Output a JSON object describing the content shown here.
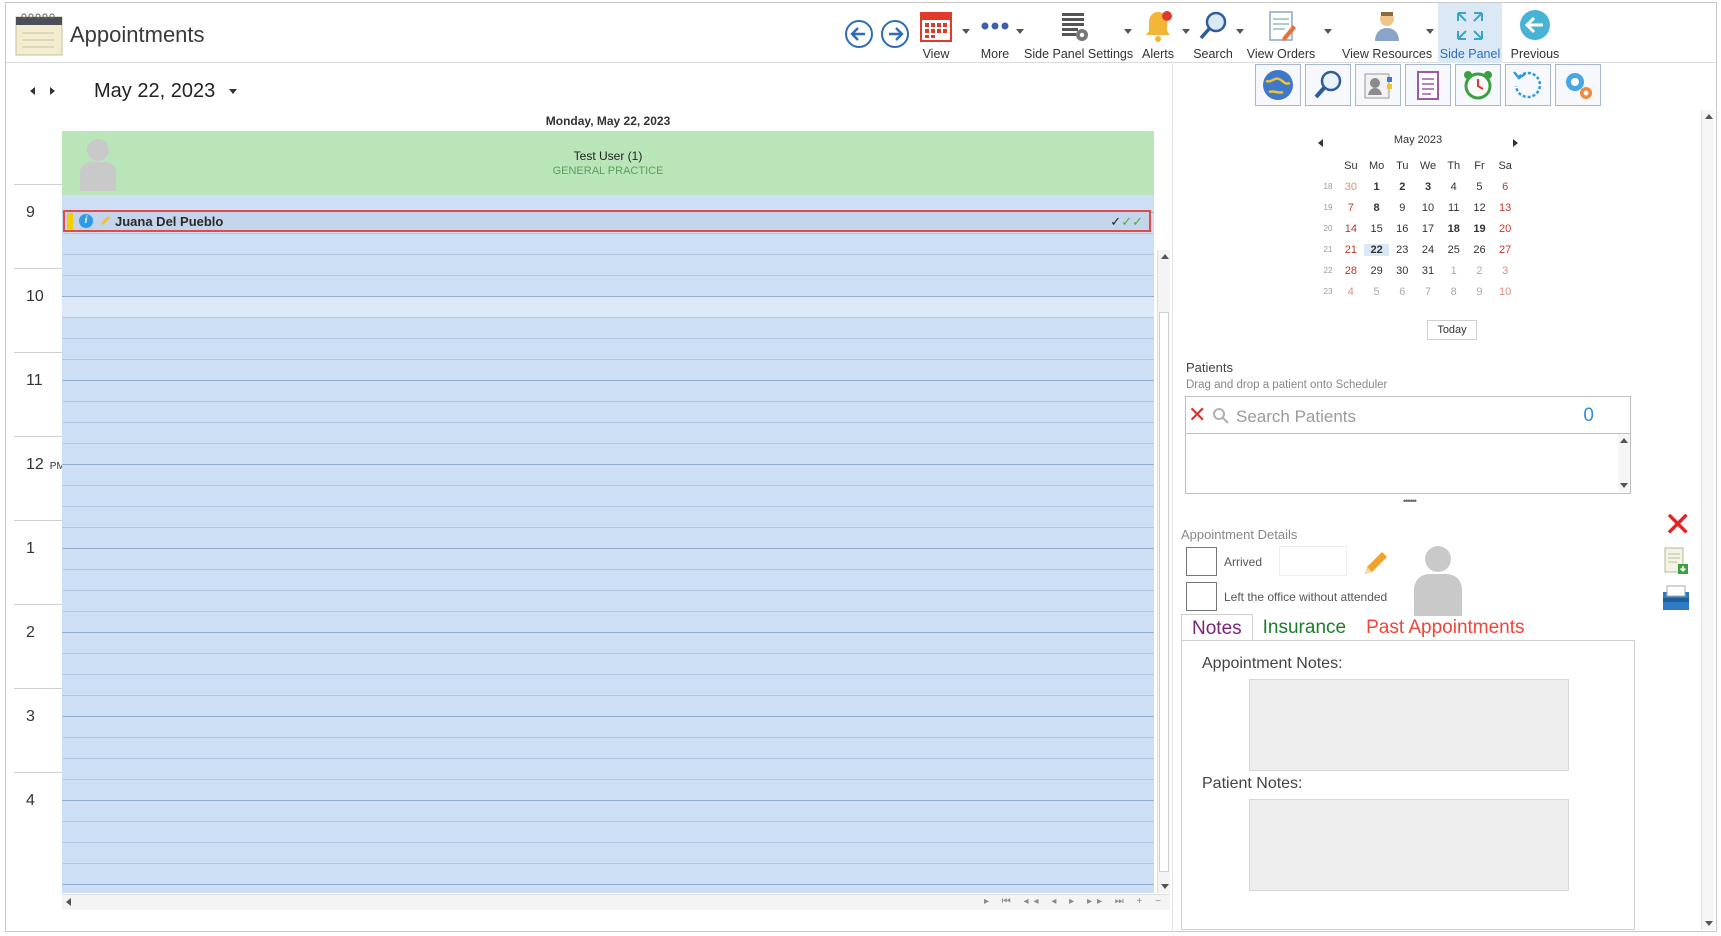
{
  "header": {
    "title": "Appointments",
    "toolbar": [
      {
        "label": "View",
        "icon": "calendar-icon"
      },
      {
        "label": "More",
        "icon": "more-dots-icon"
      },
      {
        "label": "Side Panel Settings",
        "icon": "settings-grid-icon"
      },
      {
        "label": "Alerts",
        "icon": "bell-icon"
      },
      {
        "label": "Search",
        "icon": "search-icon"
      },
      {
        "label": "View Orders",
        "icon": "orders-icon"
      },
      {
        "label": "View Resources",
        "icon": "resources-icon"
      },
      {
        "label": "Side Panel",
        "icon": "expand-icon"
      },
      {
        "label": "Previous",
        "icon": "back-arrow-icon"
      }
    ]
  },
  "scheduler": {
    "date": "May 22, 2023",
    "day_title": "Monday, May 22, 2023",
    "resource": {
      "name": "Test User (1)",
      "department": "GENERAL PRACTICE"
    },
    "hours": [
      {
        "label": "9",
        "suffix": ""
      },
      {
        "label": "10",
        "suffix": ""
      },
      {
        "label": "11",
        "suffix": ""
      },
      {
        "label": "12",
        "suffix": "PM"
      },
      {
        "label": "1",
        "suffix": ""
      },
      {
        "label": "2",
        "suffix": ""
      },
      {
        "label": "3",
        "suffix": ""
      },
      {
        "label": "4",
        "suffix": ""
      }
    ],
    "appointment": {
      "patient": "Juana Del Pueblo",
      "info": "i",
      "status_checks": "✓✓"
    }
  },
  "side_panel": {
    "mini_calendar": {
      "month": "May 2023",
      "weekdays": [
        "Su",
        "Mo",
        "Tu",
        "We",
        "Th",
        "Fr",
        "Sa"
      ],
      "weeks": [
        {
          "wk": "18",
          "days": [
            "30",
            "1",
            "2",
            "3",
            "4",
            "5",
            "6"
          ]
        },
        {
          "wk": "19",
          "days": [
            "7",
            "8",
            "9",
            "10",
            "11",
            "12",
            "13"
          ]
        },
        {
          "wk": "20",
          "days": [
            "14",
            "15",
            "16",
            "17",
            "18",
            "19",
            "20"
          ]
        },
        {
          "wk": "21",
          "days": [
            "21",
            "22",
            "23",
            "24",
            "25",
            "26",
            "27"
          ]
        },
        {
          "wk": "22",
          "days": [
            "28",
            "29",
            "30",
            "31",
            "1",
            "2",
            "3"
          ]
        },
        {
          "wk": "23",
          "days": [
            "4",
            "5",
            "6",
            "7",
            "8",
            "9",
            "10"
          ]
        }
      ],
      "selected": "22",
      "today_label": "Today"
    },
    "patients": {
      "title": "Patients",
      "subtitle": "Drag and drop a patient onto Scheduler",
      "search_placeholder": "Search Patients",
      "count": "0"
    },
    "appointment_details": {
      "title": "Appointment Details",
      "arrived_label": "Arrived",
      "left_label": "Left the office without attended"
    },
    "tabs": [
      "Notes",
      "Insurance",
      "Past Appointments"
    ],
    "notes": {
      "appointment_notes_label": "Appointment Notes:",
      "patient_notes_label": "Patient Notes:"
    },
    "colors": {
      "notes_tab": "#7a237a",
      "insurance_tab": "#1a7f2a",
      "past_tab": "#f0453a",
      "resource_header": "#b9e5b9"
    }
  }
}
